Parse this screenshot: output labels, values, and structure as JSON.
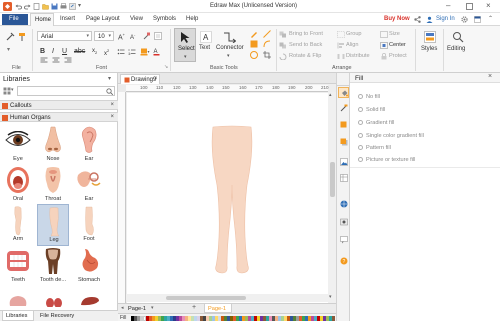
{
  "window": {
    "title": "Edraw Max (Unlicensed Version)",
    "buy_now": "Buy Now",
    "sign_in": "Sign In",
    "help": "Help"
  },
  "menu": {
    "file": "File",
    "home": "Home",
    "insert": "Insert",
    "page_layout": "Page Layout",
    "view": "View",
    "symbols": "Symbols",
    "help": "Help"
  },
  "ribbon": {
    "font_name": "Arial",
    "font_size": "10",
    "groups": {
      "file": "File",
      "font": "Font",
      "basic_tools": "Basic Tools",
      "arrange": "Arrange"
    },
    "tools": {
      "select": "Select",
      "text": "Text",
      "connector": "Connector"
    },
    "arrange": {
      "bring_to_front": "Bring to Front",
      "send_to_back": "Send to Back",
      "rotate_flip": "Rotate & Flip",
      "group": "Group",
      "align": "Align",
      "distribute": "Distribute",
      "size": "Size",
      "center": "Center",
      "protect": "Protect"
    },
    "styles": "Styles",
    "editing": "Editing"
  },
  "libraries": {
    "title": "Libraries",
    "search_placeholder": "",
    "categories": [
      "Callouts",
      "Human Organs"
    ],
    "items": [
      {
        "label": "Eye",
        "icon": "eye-icon"
      },
      {
        "label": "Nose",
        "icon": "nose-icon"
      },
      {
        "label": "Ear",
        "icon": "ear-icon"
      },
      {
        "label": "Oral",
        "icon": "mouth-icon"
      },
      {
        "label": "Throat",
        "icon": "throat-icon"
      },
      {
        "label": "Ear",
        "icon": "ear-inner-icon"
      },
      {
        "label": "Arm",
        "icon": "arm-icon"
      },
      {
        "label": "Leg",
        "icon": "leg-icon"
      },
      {
        "label": "Foot",
        "icon": "foot-icon"
      },
      {
        "label": "Teeth",
        "icon": "teeth-icon"
      },
      {
        "label": "Tooth de...",
        "icon": "tooth-decay-icon"
      },
      {
        "label": "Stomach",
        "icon": "stomach-icon"
      }
    ],
    "bottom_tabs": [
      "Libraries",
      "File Recovery"
    ]
  },
  "document": {
    "tab": "Drawing9",
    "ruler_ticks": [
      "100",
      "110",
      "120",
      "130",
      "140",
      "150",
      "160",
      "170",
      "180",
      "190",
      "200",
      "210"
    ],
    "pages": [
      "Page-1",
      "Page-1"
    ],
    "fill_label": "Fill"
  },
  "fill_panel": {
    "title": "Fill",
    "options": [
      "No fill",
      "Solid fill",
      "Gradient fill",
      "Single color gradient fill",
      "Pattern fill",
      "Picture or texture fill"
    ]
  },
  "colors": {
    "file_tab": "#2b5797",
    "accent_orange": "#f39a1e",
    "buy_now": "#d9322b",
    "sign_in": "#2d6db5",
    "selected_item": "#c9d7e8"
  }
}
